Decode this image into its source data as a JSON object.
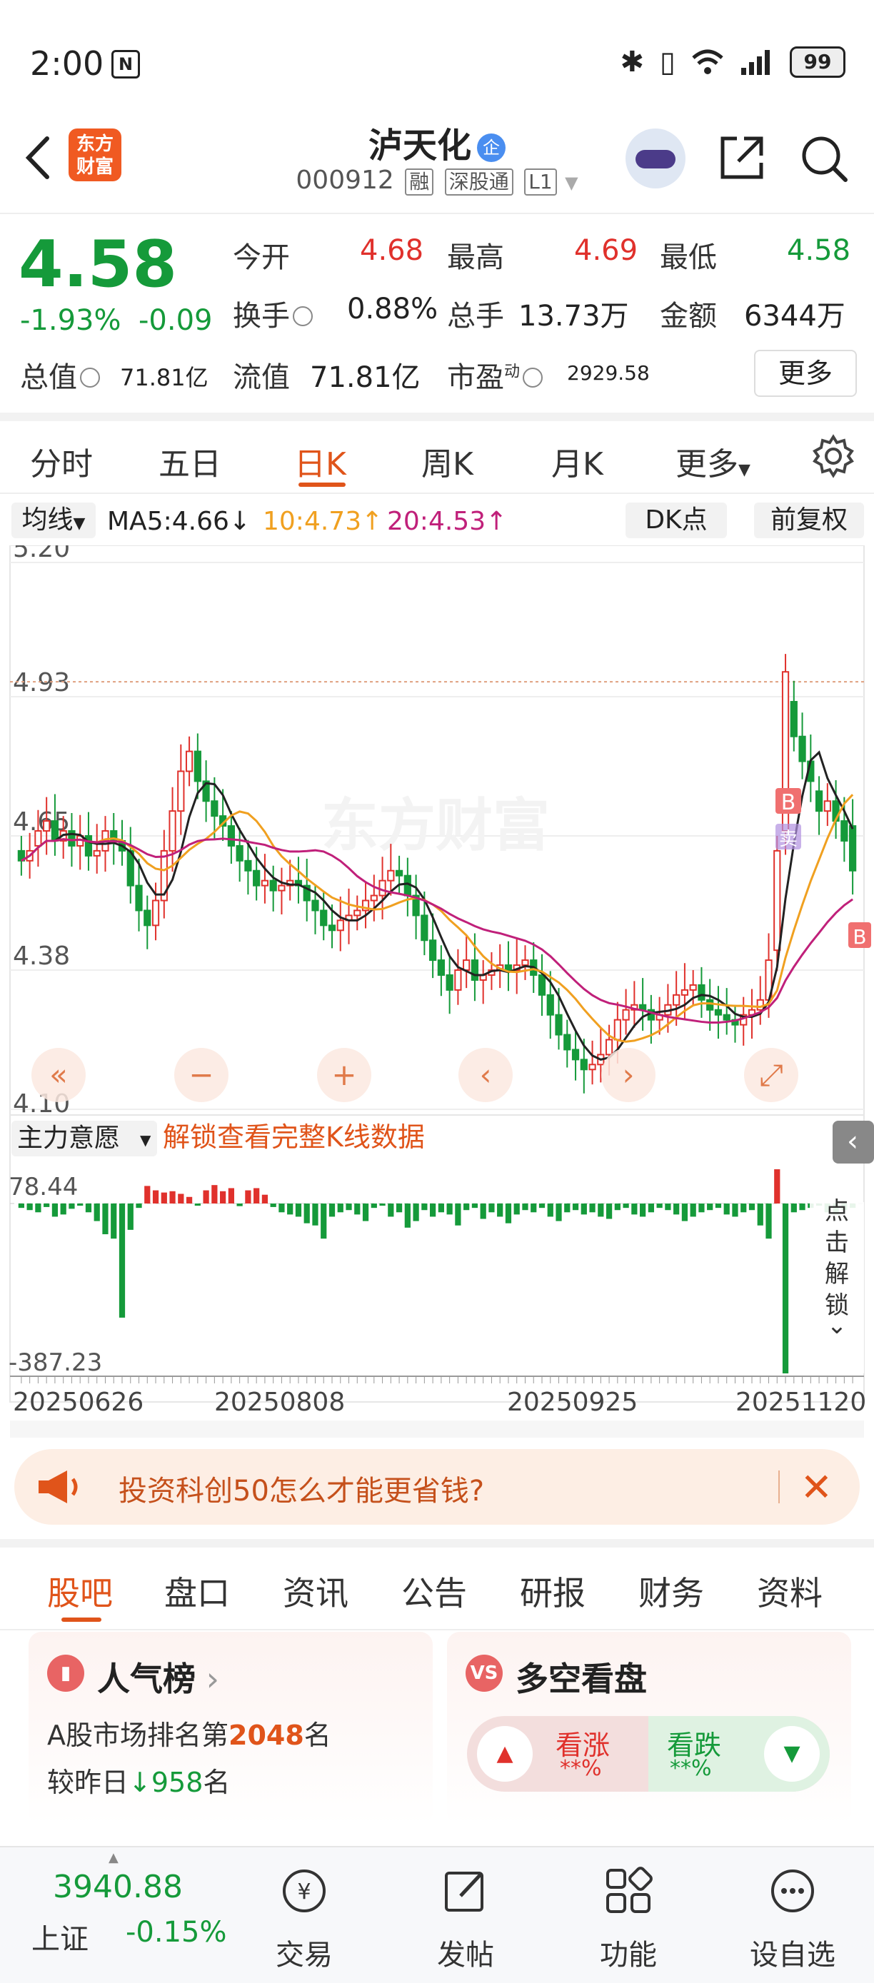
{
  "status_bar": {
    "time": "2:00",
    "battery": "99"
  },
  "header": {
    "title": "泸天化",
    "badge": "企",
    "code": "000912",
    "tags": [
      "融",
      "深股通",
      "L1"
    ],
    "logo": "东方财富"
  },
  "quote": {
    "price": "4.58",
    "change_pct": "-1.93%",
    "change": "-0.09",
    "rows": [
      [
        {
          "label": "今开",
          "value": "4.68",
          "color": "red"
        },
        {
          "label": "最高",
          "value": "4.69",
          "color": "red"
        },
        {
          "label": "最低",
          "value": "4.58",
          "color": "green"
        }
      ],
      [
        {
          "label": "换手",
          "value": "0.88%"
        },
        {
          "label": "总手",
          "value": "13.73万"
        },
        {
          "label": "金额",
          "value": "6344万"
        }
      ],
      [
        {
          "label": "总值",
          "value": "71.81亿"
        },
        {
          "label": "流值",
          "value": "71.81亿"
        },
        {
          "label": "市盈",
          "value": "2929.58",
          "sup": "动"
        }
      ]
    ],
    "more_label": "更多"
  },
  "period_tabs": {
    "items": [
      "分时",
      "五日",
      "日K",
      "周K",
      "月K",
      "更多"
    ],
    "active": "日K"
  },
  "indicators": {
    "selector": "均线",
    "ma5": "MA5:4.66↓",
    "ma10": "10:4.73↑",
    "ma20": "20:4.53↑",
    "ma5_color": "#222222",
    "ma10_color": "#f0a020",
    "ma20_color": "#c0207a",
    "dk_label": "DK点",
    "adjust_label": "前复权"
  },
  "chart_data": {
    "type": "candlestick",
    "price_axis": {
      "ticks": [
        "5.20",
        "4.93",
        "4.65",
        "4.38",
        "4.10"
      ],
      "ylim": [
        4.1,
        5.2
      ]
    },
    "x_ticks": [
      "20250626",
      "20250808",
      "20250925",
      "20251120"
    ],
    "watermark": "东方财富",
    "markers": [
      "B",
      "B",
      "卖"
    ],
    "lower_indicator": {
      "name": "主力意愿",
      "top_label": "78.44",
      "bottom_label": "-387.23",
      "unlock_text": "解锁查看完整K线数据",
      "side_button": "点击解锁"
    },
    "ma_colors": {
      "ma5": "#222222",
      "ma10": "#f0a020",
      "ma20": "#c0207a"
    },
    "closes": [
      4.6,
      4.62,
      4.66,
      4.68,
      4.64,
      4.66,
      4.63,
      4.65,
      4.61,
      4.62,
      4.66,
      4.64,
      4.62,
      4.55,
      4.5,
      4.47,
      4.52,
      4.62,
      4.7,
      4.78,
      4.82,
      4.76,
      4.72,
      4.69,
      4.67,
      4.63,
      4.6,
      4.58,
      4.55,
      4.56,
      4.54,
      4.55,
      4.56,
      4.55,
      4.52,
      4.5,
      4.47,
      4.46,
      4.48,
      4.49,
      4.5,
      4.52,
      4.53,
      4.56,
      4.58,
      4.57,
      4.53,
      4.49,
      4.44,
      4.4,
      4.37,
      4.34,
      4.38,
      4.4,
      4.36,
      4.37,
      4.38,
      4.39,
      4.38,
      4.39,
      4.4,
      4.37,
      4.33,
      4.29,
      4.25,
      4.22,
      4.2,
      4.18,
      4.19,
      4.21,
      4.24,
      4.28,
      4.3,
      4.31,
      4.3,
      4.28,
      4.29,
      4.31,
      4.33,
      4.34,
      4.35,
      4.32,
      4.3,
      4.29,
      4.28,
      4.27,
      4.29,
      4.3,
      4.32,
      4.4,
      4.62,
      4.98,
      4.85,
      4.8,
      4.76,
      4.7,
      4.72,
      4.68,
      4.64,
      4.58
    ],
    "opens": [
      4.62,
      4.6,
      4.63,
      4.66,
      4.68,
      4.64,
      4.66,
      4.63,
      4.65,
      4.61,
      4.62,
      4.66,
      4.64,
      4.62,
      4.55,
      4.5,
      4.47,
      4.52,
      4.62,
      4.7,
      4.78,
      4.82,
      4.76,
      4.72,
      4.69,
      4.67,
      4.63,
      4.6,
      4.58,
      4.55,
      4.56,
      4.54,
      4.55,
      4.56,
      4.55,
      4.52,
      4.5,
      4.47,
      4.46,
      4.48,
      4.49,
      4.5,
      4.52,
      4.53,
      4.56,
      4.58,
      4.57,
      4.53,
      4.49,
      4.44,
      4.4,
      4.37,
      4.34,
      4.38,
      4.4,
      4.36,
      4.37,
      4.38,
      4.39,
      4.38,
      4.39,
      4.4,
      4.37,
      4.33,
      4.29,
      4.25,
      4.22,
      4.2,
      4.18,
      4.19,
      4.21,
      4.24,
      4.28,
      4.3,
      4.31,
      4.3,
      4.28,
      4.29,
      4.31,
      4.33,
      4.34,
      4.35,
      4.32,
      4.3,
      4.29,
      4.28,
      4.27,
      4.29,
      4.3,
      4.32,
      4.42,
      4.66,
      4.92,
      4.85,
      4.8,
      4.74,
      4.7,
      4.72,
      4.68,
      4.67
    ],
    "mainflow": [
      -10,
      -15,
      -20,
      -8,
      -30,
      -25,
      -12,
      -5,
      -20,
      -40,
      -70,
      -80,
      -260,
      -60,
      -10,
      40,
      30,
      25,
      28,
      22,
      15,
      -5,
      30,
      42,
      28,
      35,
      -6,
      30,
      35,
      20,
      -8,
      -20,
      -25,
      -30,
      -45,
      -50,
      -80,
      -30,
      -20,
      -15,
      -25,
      -40,
      -10,
      -5,
      -30,
      -20,
      -55,
      -40,
      -15,
      -30,
      -20,
      -25,
      -50,
      -15,
      -10,
      -35,
      -20,
      -30,
      -45,
      -25,
      -15,
      -20,
      -10,
      -30,
      -40,
      -20,
      -15,
      -25,
      -20,
      -30,
      -35,
      -15,
      -10,
      -25,
      -30,
      -20,
      -10,
      -15,
      -25,
      -40,
      -30,
      -20,
      -15,
      -10,
      -25,
      -30,
      -20,
      -15,
      -50,
      -80,
      78,
      -387,
      -20,
      -15,
      -10,
      -5,
      -20,
      -25,
      -15,
      -10
    ]
  },
  "chart_controls": [
    "«",
    "−",
    "+",
    "‹",
    "›",
    "⤢"
  ],
  "banner": {
    "text": "投资科创50怎么才能更省钱?"
  },
  "content_tabs": {
    "items": [
      "股吧",
      "盘口",
      "资讯",
      "公告",
      "研报",
      "财务",
      "资料"
    ],
    "active": "股吧"
  },
  "popularity_card": {
    "title": "人气榜",
    "line1_prefix": "A股市场排名第",
    "rank": "2048",
    "line1_suffix": "名",
    "line2_prefix": "较昨日",
    "delta": "958",
    "line2_suffix": "名"
  },
  "bullbear_card": {
    "title": "多空看盘",
    "up_label": "看涨",
    "up_value": "**%",
    "down_label": "看跌",
    "down_value": "**%"
  },
  "bottom_nav": {
    "index_value": "3940.88",
    "index_name": "上证",
    "index_change": "-0.15%",
    "items": [
      "交易",
      "发帖",
      "功能",
      "设自选"
    ]
  }
}
